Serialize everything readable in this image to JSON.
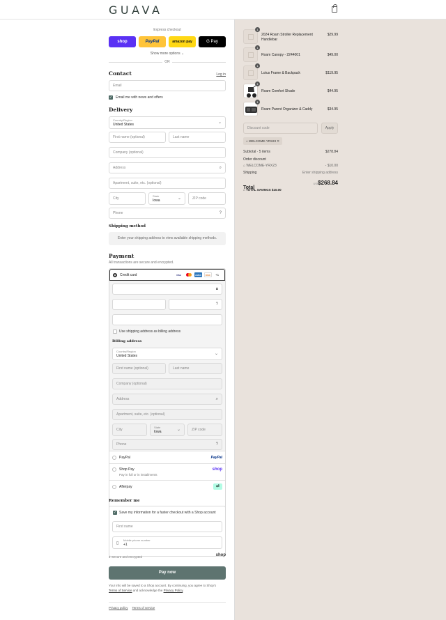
{
  "header": {
    "logo": "GUAVA",
    "cart_icon": "shopping-bag-icon"
  },
  "express": {
    "label": "Express checkout",
    "buttons": [
      "shop",
      "PayPal",
      "amazon pay",
      "G Pay"
    ],
    "show_more": "Show more options",
    "or": "OR"
  },
  "contact": {
    "title": "Contact",
    "login": "Log in",
    "email_placeholder": "Email",
    "news_label": "Email me with news and offers"
  },
  "delivery": {
    "title": "Delivery",
    "country_label": "Country/Region",
    "country_value": "United States",
    "first_name": "First name (optional)",
    "last_name": "Last name",
    "company": "Company (optional)",
    "address": "Address",
    "apartment": "Apartment, suite, etc. (optional)",
    "city": "City",
    "state_label": "State",
    "state_value": "Iowa",
    "zip": "ZIP code",
    "phone": "Phone"
  },
  "shipping_method": {
    "title": "Shipping method",
    "notice": "Enter your shipping address to view available shipping methods."
  },
  "payment": {
    "title": "Payment",
    "subtitle": "All transactions are secure and encrypted.",
    "credit_card_label": "Credit card",
    "card_logos": [
      "VISA",
      "MC",
      "AMEX",
      "DISC"
    ],
    "more_cards": "+1",
    "billing_same_label": "Use shipping address as billing address",
    "billing_title": "Billing address",
    "paypal_label": "PayPal",
    "shoppay_label": "Shop Pay",
    "shoppay_sub": "Pay in full or in installments",
    "afterpay_label": "Afterpay"
  },
  "remember": {
    "title": "Remember me",
    "save_label": "Save my information for a faster checkout with a Shop account",
    "first_name": "First name",
    "mobile_label": "Mobile phone number",
    "mobile_value": "+1"
  },
  "secure_text": "Secure and encrypted",
  "shop_mark": "shop",
  "pay_now": "Pay now",
  "legal": {
    "line1": "Your info will be saved to a Shop account. By continuing, you agree to Shop's",
    "terms": "Terms of Service",
    "mid": " and acknowledge the ",
    "privacy": "Privacy Policy",
    "end": "."
  },
  "footer": {
    "privacy": "Privacy policy",
    "terms": "Terms of service"
  },
  "cart": {
    "items": [
      {
        "name": "2024 Roam Stroller Replacement Handlebar",
        "price": "$29.99",
        "qty": "1"
      },
      {
        "name": "Roam Canopy - 2244001",
        "price": "$49.00",
        "qty": "1"
      },
      {
        "name": "Lotus Frame & Backpack",
        "price": "$119.95",
        "qty": "1"
      },
      {
        "name": "Roam Comfort Shade",
        "price": "$44.95",
        "qty": "1"
      },
      {
        "name": "Roam Parent Organizer & Caddy",
        "price": "$34.95",
        "qty": "1"
      }
    ],
    "discount_placeholder": "Discount code",
    "apply": "Apply",
    "tag": "WELCOME-YRX23",
    "subtotal_label": "Subtotal · 5 items",
    "subtotal_value": "$278.84",
    "order_discount_label": "Order discount",
    "discount_code": "WELCOME-YRX23",
    "discount_value": "- $10.00",
    "shipping_label": "Shipping",
    "shipping_value": "Enter shipping address",
    "total_label": "Total",
    "currency": "USD",
    "total_value": "$268.84",
    "savings": "TOTAL SAVINGS  $10.00"
  }
}
